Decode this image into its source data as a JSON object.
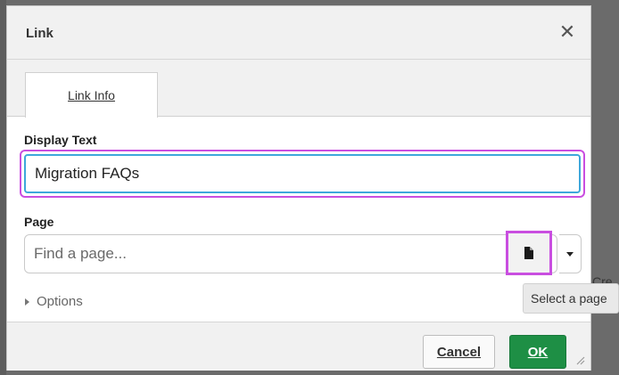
{
  "dialog": {
    "title": "Link",
    "close_symbol": "✕"
  },
  "tabs": [
    {
      "label": "Link Info",
      "active": true
    }
  ],
  "display_text": {
    "label": "Display Text",
    "value": "Migration FAQs"
  },
  "page": {
    "label": "Page",
    "placeholder": "Find a page...",
    "select_button_icon": "document-icon",
    "dropdown_icon": "caret-down-icon"
  },
  "options": {
    "label": "Options",
    "icon": "triangle-right-icon"
  },
  "tooltip": {
    "text": "Select a page"
  },
  "background": {
    "partial_text": "Cre"
  },
  "footer": {
    "cancel_label": "Cancel",
    "ok_label": "OK"
  },
  "colors": {
    "accent_highlight": "#c94ee0",
    "focus_border": "#3ea7db",
    "ok_button": "#1e8f45"
  }
}
